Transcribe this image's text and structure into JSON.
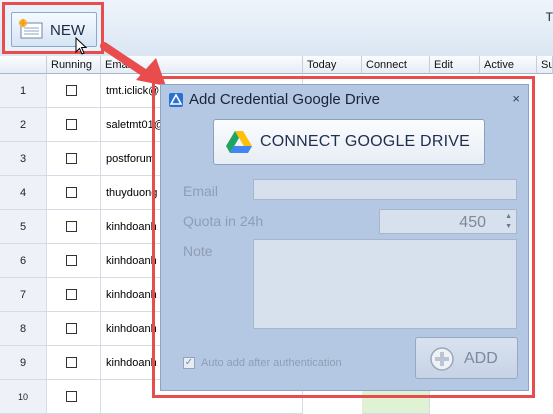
{
  "toolbar": {
    "new_label": "NEW",
    "right_text": "T"
  },
  "grid": {
    "headers": [
      "Running",
      "Email",
      "Today",
      "Connect",
      "Edit",
      "Active",
      "Su"
    ],
    "rows": [
      {
        "num": "1",
        "email": "tmt.iclick@"
      },
      {
        "num": "2",
        "email": "saletmt01@"
      },
      {
        "num": "3",
        "email": "postforum"
      },
      {
        "num": "4",
        "email": "thuyduong"
      },
      {
        "num": "5",
        "email": "kinhdoanh"
      },
      {
        "num": "6",
        "email": "kinhdoanh"
      },
      {
        "num": "7",
        "email": "kinhdoanh"
      },
      {
        "num": "8",
        "email": "kinhdoanh"
      },
      {
        "num": "9",
        "email": "kinhdoanh"
      },
      {
        "num": "10",
        "email": ""
      }
    ]
  },
  "dialog": {
    "title": "Add Credential Google Drive",
    "close": "×",
    "connect_label": "CONNECT GOOGLE DRIVE",
    "email_label": "Email",
    "email_value": "",
    "quota_label": "Quota in 24h",
    "quota_value": "450",
    "note_label": "Note",
    "note_value": "",
    "auto_add_label": "Auto add after authentication",
    "auto_add_checked": true,
    "add_label": "ADD"
  },
  "colors": {
    "highlight": "#e84c4c",
    "dialog_bg": "#b4c8e4"
  }
}
